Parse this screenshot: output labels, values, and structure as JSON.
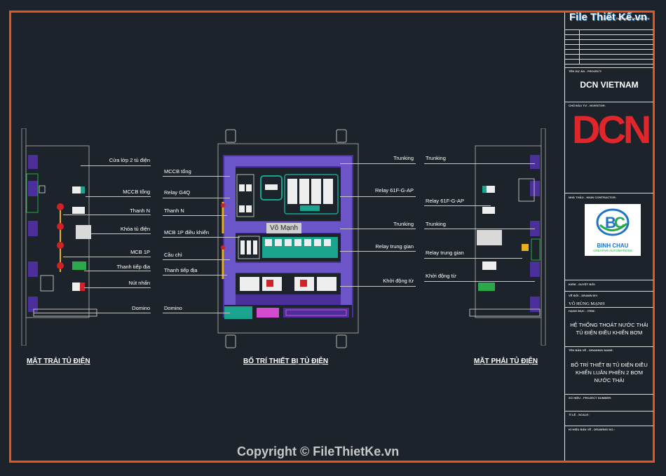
{
  "watermark_top": "File Thiết Kế.vn",
  "watermark_bottom": "Copyright © FileThietKe.vn",
  "sidebar": {
    "small_header": "CÔNG TY TNHH MỘT THÀNH VIÊN",
    "project_label": "TÊN DỰ ÁN - PROJECT:",
    "project": "DCN VIETNAM",
    "owner_label": "CHỦ ĐẦU TƯ - INVESTOR:",
    "logo_text": "DCN",
    "contractor_label": "NHÀ THẦU - MAIN CONTRACTOR:",
    "contractor_name": "BINH CHAU",
    "contractor_tagline": "CREATIVE AUTOMATIONS",
    "checked_label": "KIỂM - DUYỆT BỞI:",
    "drawn_label": "VẼ BỞI - DRAWN BY:",
    "drawn_by": "VÕ HÙNG MẠNH",
    "category_label": "HẠNG MỤC - ITEM:",
    "category": "HỆ THỐNG THOÁT NƯỚC THẢI TỦ ĐIỆN ĐIỀU KHIỂN BƠM",
    "drawing_title_label": "TÊN BẢN VẼ - DRAWING NAME:",
    "drawing_title": "BỐ TRÍ THIẾT BỊ TỦ ĐIỆN ĐIỀU KHIỂN LUÂN PHIÊN 2 BƠM NƯỚC THẢI",
    "drawing_no_label": "SỐ HIỆU - PROJECT NUMBER:",
    "scale_label": "TỈ LỆ - SCALE:",
    "sheet_label": "KÍ HIỆU BẢN VẼ - DRAWING NO.:"
  },
  "views": {
    "left_title": "MẶT TRÁI TỦ ĐIỆN",
    "center_title": "BỐ TRÍ THIẾT BỊ TỦ ĐIỆN",
    "right_title": "MẶT PHẢI TỦ ĐIỆN",
    "center_nameplate": "Võ Mạnh"
  },
  "left_labels": [
    "Cửa lớp 2 tủ điện",
    "MCCB tổng",
    "Thanh N",
    "Khóa tủ điện",
    "MCB 1P",
    "Thanh tiếp địa",
    "Nút nhấn",
    "Domino"
  ],
  "center_left_labels": [
    "MCCB tổng",
    "Relay G4Q",
    "Thanh N",
    "MCB 1P điều khiển",
    "Cầu chì",
    "Thanh tiếp địa",
    "Domino"
  ],
  "center_right_labels": [
    "Trunking",
    "Relay 61F-G-AP",
    "Trunking",
    "Relay trung gian",
    "Khởi động từ"
  ],
  "right_labels": [
    "Trunking",
    "Relay 61F-G-AP",
    "Trunking",
    "Relay trung gian",
    "Khởi động từ"
  ],
  "colors": {
    "frame": "#e8541d",
    "background": "#1d232a",
    "panel": "#4b2f9a",
    "trunking": "#6b55c9",
    "relay": "#1aa38f",
    "logo_red": "#e0252b"
  }
}
